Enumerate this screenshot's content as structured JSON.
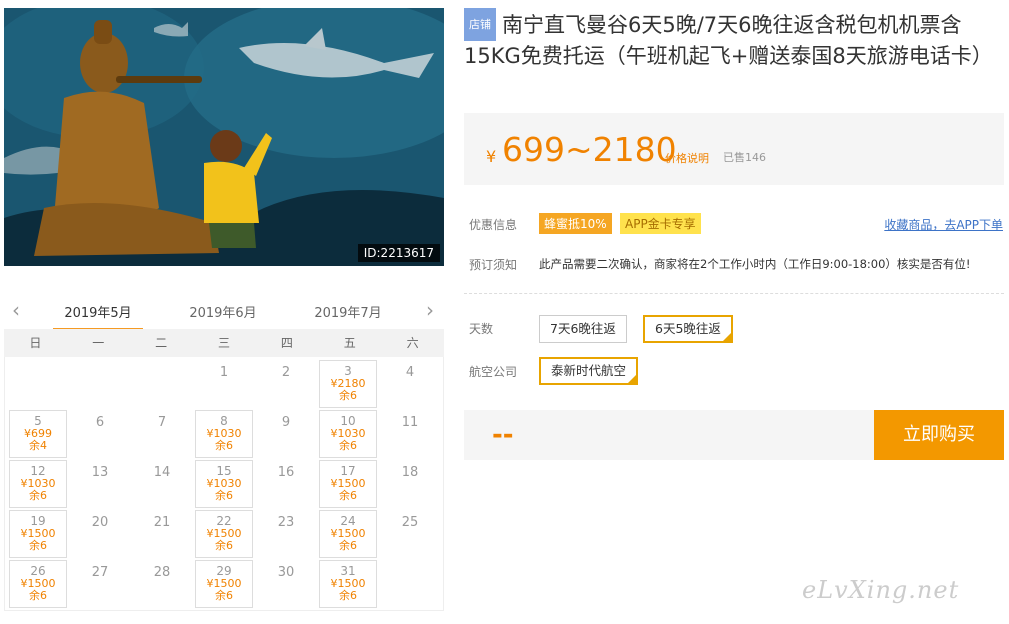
{
  "hero": {
    "image_id": "ID:2213617"
  },
  "calendar": {
    "prev_icon": "‹",
    "next_icon": "›",
    "months": [
      "2019年5月",
      "2019年6月",
      "2019年7月"
    ],
    "weekdays": [
      "日",
      "一",
      "二",
      "三",
      "四",
      "五",
      "六"
    ],
    "days": {
      "d1": "1",
      "d2": "2",
      "d3": "3",
      "d4": "4",
      "d5": "5",
      "d6": "6",
      "d7": "7",
      "d8": "8",
      "d9": "9",
      "d10": "10",
      "d11": "11",
      "d12": "12",
      "d13": "13",
      "d14": "14",
      "d15": "15",
      "d16": "16",
      "d17": "17",
      "d18": "18",
      "d19": "19",
      "d20": "20",
      "d21": "21",
      "d22": "22",
      "d23": "23",
      "d24": "24",
      "d25": "25",
      "d26": "26",
      "d27": "27",
      "d28": "28",
      "d29": "29",
      "d30": "30",
      "d31": "31"
    },
    "prices": {
      "d3": "¥2180",
      "d5": "¥699",
      "d8": "¥1030",
      "d10": "¥1030",
      "d12": "¥1030",
      "d15": "¥1030",
      "d17": "¥1500",
      "d19": "¥1500",
      "d22": "¥1500",
      "d24": "¥1500",
      "d26": "¥1500",
      "d29": "¥1500",
      "d31": "¥1500"
    },
    "stock": {
      "d3": "余6",
      "d5": "余4",
      "d8": "余6",
      "d10": "余6",
      "d12": "余6",
      "d15": "余6",
      "d17": "余6",
      "d19": "余6",
      "d22": "余6",
      "d24": "余6",
      "d26": "余6",
      "d29": "余6",
      "d31": "余6"
    }
  },
  "product": {
    "shop_badge": "店铺",
    "title": "南宁直飞曼谷6天5晚/7天6晚往返含税包机机票含15KG免费托运（午班机起飞+赠送泰国8天旅游电话卡）",
    "price_symbol": "¥",
    "price_range": "699~2180",
    "price_note": "价格说明",
    "sold": "已售146"
  },
  "promo": {
    "label": "优惠信息",
    "tag1": "蜂蜜抵10%",
    "tag2": "APP金卡专享",
    "fav_link": "收藏商品，去APP下单"
  },
  "booking_notice": {
    "label": "预订须知",
    "text": "此产品需要二次确认，商家将在2个工作小时内（工作日9:00-18:00）核实是否有位!"
  },
  "options": {
    "days_label": "天数",
    "days_opt1": "7天6晚往返",
    "days_opt2": "6天5晚往返",
    "airline_label": "航空公司",
    "airline_opt1": "泰新时代航空"
  },
  "buy": {
    "total": "--",
    "button": "立即购买"
  },
  "watermark": "eLvXing.net"
}
